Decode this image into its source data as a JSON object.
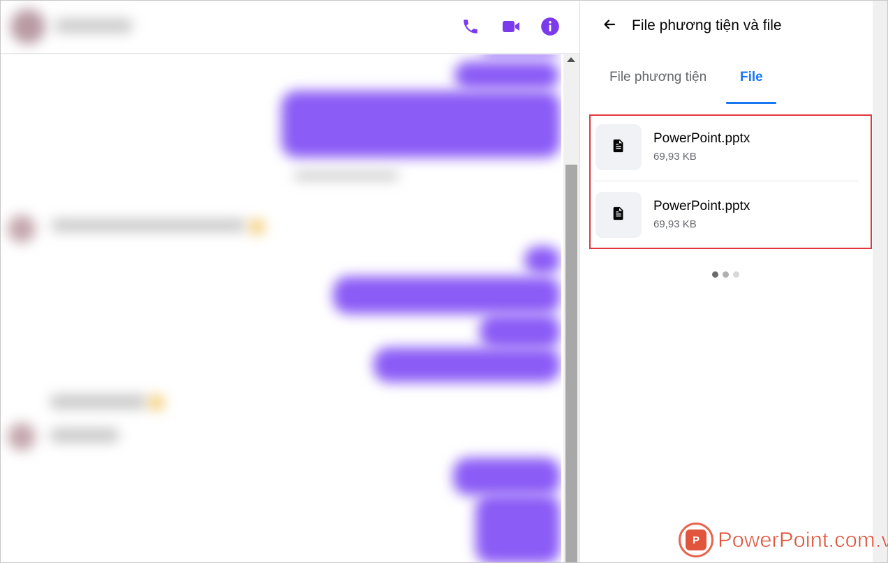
{
  "panel": {
    "title": "File phương tiện và file",
    "tabs": [
      {
        "label": "File phương tiện",
        "active": false
      },
      {
        "label": "File",
        "active": true
      }
    ],
    "files": [
      {
        "name": "PowerPoint.pptx",
        "size": "69,93 KB",
        "icon": "document-icon"
      },
      {
        "name": "PowerPoint.pptx",
        "size": "69,93 KB",
        "icon": "document-icon"
      }
    ],
    "pagination": {
      "total": 3,
      "current": 1
    }
  },
  "chat_header": {
    "icons": [
      "phone-icon",
      "video-camera-icon",
      "info-icon"
    ],
    "accent_color": "#7c3aed"
  },
  "colors": {
    "tab_active": "#1877f2",
    "highlight_box": "#e0383e",
    "bubble": "#8b5cf6"
  },
  "watermark": {
    "brand": "PowerPoint.com.vn",
    "badge": "P"
  }
}
